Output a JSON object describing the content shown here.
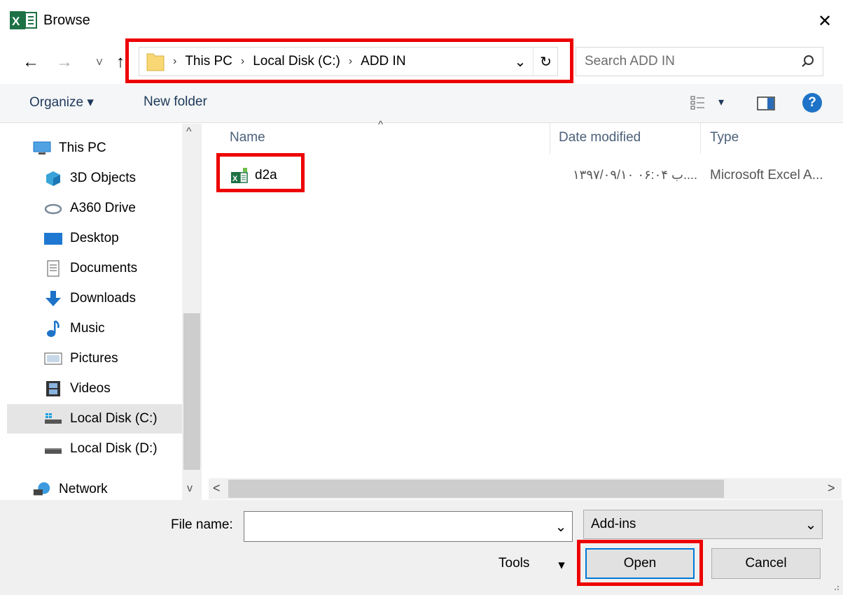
{
  "window": {
    "title": "Browse",
    "close_glyph": "✕"
  },
  "nav": {
    "back_glyph": "←",
    "forward_glyph": "→",
    "recent_glyph": "˅",
    "up_glyph": "↑",
    "breadcrumbs": [
      "This PC",
      "Local Disk (C:)",
      "ADD IN"
    ],
    "dropdown_glyph": "⌄",
    "refresh_glyph": "↻",
    "search_placeholder": "Search ADD IN"
  },
  "toolbar": {
    "organize_label": "Organize ▾",
    "new_folder_label": "New folder",
    "view_dd_glyph": "▾",
    "help_glyph": "?"
  },
  "sidebar": {
    "items": [
      {
        "label": "This PC",
        "icon": "pc-icon"
      },
      {
        "label": "3D Objects",
        "icon": "cube-icon"
      },
      {
        "label": "A360 Drive",
        "icon": "cloud-drive-icon"
      },
      {
        "label": "Desktop",
        "icon": "desktop-icon"
      },
      {
        "label": "Documents",
        "icon": "documents-icon"
      },
      {
        "label": "Downloads",
        "icon": "download-arrow-icon"
      },
      {
        "label": "Music",
        "icon": "music-note-icon"
      },
      {
        "label": "Pictures",
        "icon": "pictures-icon"
      },
      {
        "label": "Videos",
        "icon": "film-icon"
      },
      {
        "label": "Local Disk (C:)",
        "icon": "drive-windows-icon",
        "selected": true
      },
      {
        "label": "Local Disk (D:)",
        "icon": "drive-icon"
      },
      {
        "label": "Network",
        "icon": "network-icon"
      }
    ]
  },
  "file_list": {
    "columns": [
      "Name",
      "Date modified",
      "Type"
    ],
    "sort_glyph": "^",
    "files": [
      {
        "name": "d2a",
        "date": "۱۳۹۷/۰۹/۱۰ ب ۰۶:۰۴....",
        "type": "Microsoft Excel A..."
      }
    ]
  },
  "scroll": {
    "up_glyph": "^",
    "down_glyph": "v",
    "left_glyph": "<",
    "right_glyph": ">"
  },
  "footer": {
    "file_name_label": "File name:",
    "file_name_value": "",
    "file_type_value": "Add-ins",
    "dd_glyph": "⌄",
    "tools_label": "Tools",
    "tools_dd_glyph": "▾",
    "open_label": "Open",
    "cancel_label": "Cancel"
  },
  "colors": {
    "highlight": "#ee0000",
    "excel_green": "#1e7145",
    "accent_blue": "#0078d7"
  }
}
